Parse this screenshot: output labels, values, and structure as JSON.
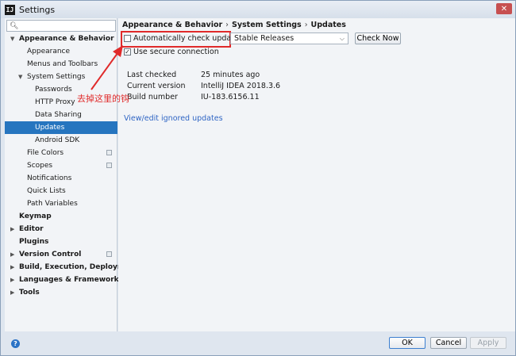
{
  "window": {
    "title": "Settings",
    "app_icon": "IJ"
  },
  "search": {
    "placeholder": ""
  },
  "sidebar": {
    "items": [
      {
        "label": "Appearance & Behavior",
        "level": 0,
        "bold": true,
        "expanded": true
      },
      {
        "label": "Appearance",
        "level": 1
      },
      {
        "label": "Menus and Toolbars",
        "level": 1
      },
      {
        "label": "System Settings",
        "level": 1,
        "expanded": true
      },
      {
        "label": "Passwords",
        "level": 2
      },
      {
        "label": "HTTP Proxy",
        "level": 2
      },
      {
        "label": "Data Sharing",
        "level": 2
      },
      {
        "label": "Updates",
        "level": 2,
        "selected": true
      },
      {
        "label": "Android SDK",
        "level": 2
      },
      {
        "label": "File Colors",
        "level": 1,
        "project": true
      },
      {
        "label": "Scopes",
        "level": 1,
        "project": true
      },
      {
        "label": "Notifications",
        "level": 1
      },
      {
        "label": "Quick Lists",
        "level": 1
      },
      {
        "label": "Path Variables",
        "level": 1
      },
      {
        "label": "Keymap",
        "level": 0,
        "bold": true
      },
      {
        "label": "Editor",
        "level": 0,
        "bold": true,
        "collapsed": true
      },
      {
        "label": "Plugins",
        "level": 0,
        "bold": true
      },
      {
        "label": "Version Control",
        "level": 0,
        "bold": true,
        "collapsed": true,
        "project": true
      },
      {
        "label": "Build, Execution, Deployment",
        "level": 0,
        "bold": true,
        "collapsed": true
      },
      {
        "label": "Languages & Frameworks",
        "level": 0,
        "bold": true,
        "collapsed": true
      },
      {
        "label": "Tools",
        "level": 0,
        "bold": true,
        "collapsed": true
      }
    ]
  },
  "breadcrumb": {
    "part1": "Appearance & Behavior",
    "part2": "System Settings",
    "part3": "Updates",
    "separator": "›"
  },
  "updates": {
    "auto_check_label": "Automatically check updates for",
    "auto_check_checked": false,
    "channel_selected": "Stable Releases",
    "check_now_label": "Check Now",
    "secure_label": "Use secure connection",
    "secure_checked": true,
    "info": [
      {
        "key": "Last checked",
        "value": "25 minutes ago"
      },
      {
        "key": "Current version",
        "value": "IntelliJ IDEA 2018.3.6"
      },
      {
        "key": "Build number",
        "value": "IU-183.6156.11"
      }
    ],
    "ignored_link": "View/edit ignored updates"
  },
  "annotation": {
    "text": "去掉这里的钩",
    "color": "#e02a2a"
  },
  "footer": {
    "help": "?",
    "ok": "OK",
    "cancel": "Cancel",
    "apply": "Apply"
  },
  "colors": {
    "selected": "#2675bf",
    "link": "#2f65c4",
    "highlight": "#e02a2a"
  }
}
